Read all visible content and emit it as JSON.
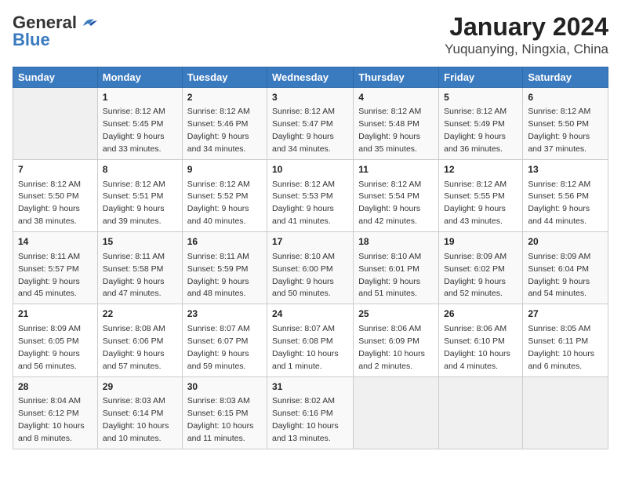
{
  "logo": {
    "general": "General",
    "blue": "Blue"
  },
  "title": "January 2024",
  "subtitle": "Yuquanying, Ningxia, China",
  "days_of_week": [
    "Sunday",
    "Monday",
    "Tuesday",
    "Wednesday",
    "Thursday",
    "Friday",
    "Saturday"
  ],
  "weeks": [
    [
      {
        "day": "",
        "info": ""
      },
      {
        "day": "1",
        "info": "Sunrise: 8:12 AM\nSunset: 5:45 PM\nDaylight: 9 hours\nand 33 minutes."
      },
      {
        "day": "2",
        "info": "Sunrise: 8:12 AM\nSunset: 5:46 PM\nDaylight: 9 hours\nand 34 minutes."
      },
      {
        "day": "3",
        "info": "Sunrise: 8:12 AM\nSunset: 5:47 PM\nDaylight: 9 hours\nand 34 minutes."
      },
      {
        "day": "4",
        "info": "Sunrise: 8:12 AM\nSunset: 5:48 PM\nDaylight: 9 hours\nand 35 minutes."
      },
      {
        "day": "5",
        "info": "Sunrise: 8:12 AM\nSunset: 5:49 PM\nDaylight: 9 hours\nand 36 minutes."
      },
      {
        "day": "6",
        "info": "Sunrise: 8:12 AM\nSunset: 5:50 PM\nDaylight: 9 hours\nand 37 minutes."
      }
    ],
    [
      {
        "day": "7",
        "info": "Sunrise: 8:12 AM\nSunset: 5:50 PM\nDaylight: 9 hours\nand 38 minutes."
      },
      {
        "day": "8",
        "info": "Sunrise: 8:12 AM\nSunset: 5:51 PM\nDaylight: 9 hours\nand 39 minutes."
      },
      {
        "day": "9",
        "info": "Sunrise: 8:12 AM\nSunset: 5:52 PM\nDaylight: 9 hours\nand 40 minutes."
      },
      {
        "day": "10",
        "info": "Sunrise: 8:12 AM\nSunset: 5:53 PM\nDaylight: 9 hours\nand 41 minutes."
      },
      {
        "day": "11",
        "info": "Sunrise: 8:12 AM\nSunset: 5:54 PM\nDaylight: 9 hours\nand 42 minutes."
      },
      {
        "day": "12",
        "info": "Sunrise: 8:12 AM\nSunset: 5:55 PM\nDaylight: 9 hours\nand 43 minutes."
      },
      {
        "day": "13",
        "info": "Sunrise: 8:12 AM\nSunset: 5:56 PM\nDaylight: 9 hours\nand 44 minutes."
      }
    ],
    [
      {
        "day": "14",
        "info": "Sunrise: 8:11 AM\nSunset: 5:57 PM\nDaylight: 9 hours\nand 45 minutes."
      },
      {
        "day": "15",
        "info": "Sunrise: 8:11 AM\nSunset: 5:58 PM\nDaylight: 9 hours\nand 47 minutes."
      },
      {
        "day": "16",
        "info": "Sunrise: 8:11 AM\nSunset: 5:59 PM\nDaylight: 9 hours\nand 48 minutes."
      },
      {
        "day": "17",
        "info": "Sunrise: 8:10 AM\nSunset: 6:00 PM\nDaylight: 9 hours\nand 50 minutes."
      },
      {
        "day": "18",
        "info": "Sunrise: 8:10 AM\nSunset: 6:01 PM\nDaylight: 9 hours\nand 51 minutes."
      },
      {
        "day": "19",
        "info": "Sunrise: 8:09 AM\nSunset: 6:02 PM\nDaylight: 9 hours\nand 52 minutes."
      },
      {
        "day": "20",
        "info": "Sunrise: 8:09 AM\nSunset: 6:04 PM\nDaylight: 9 hours\nand 54 minutes."
      }
    ],
    [
      {
        "day": "21",
        "info": "Sunrise: 8:09 AM\nSunset: 6:05 PM\nDaylight: 9 hours\nand 56 minutes."
      },
      {
        "day": "22",
        "info": "Sunrise: 8:08 AM\nSunset: 6:06 PM\nDaylight: 9 hours\nand 57 minutes."
      },
      {
        "day": "23",
        "info": "Sunrise: 8:07 AM\nSunset: 6:07 PM\nDaylight: 9 hours\nand 59 minutes."
      },
      {
        "day": "24",
        "info": "Sunrise: 8:07 AM\nSunset: 6:08 PM\nDaylight: 10 hours\nand 1 minute."
      },
      {
        "day": "25",
        "info": "Sunrise: 8:06 AM\nSunset: 6:09 PM\nDaylight: 10 hours\nand 2 minutes."
      },
      {
        "day": "26",
        "info": "Sunrise: 8:06 AM\nSunset: 6:10 PM\nDaylight: 10 hours\nand 4 minutes."
      },
      {
        "day": "27",
        "info": "Sunrise: 8:05 AM\nSunset: 6:11 PM\nDaylight: 10 hours\nand 6 minutes."
      }
    ],
    [
      {
        "day": "28",
        "info": "Sunrise: 8:04 AM\nSunset: 6:12 PM\nDaylight: 10 hours\nand 8 minutes."
      },
      {
        "day": "29",
        "info": "Sunrise: 8:03 AM\nSunset: 6:14 PM\nDaylight: 10 hours\nand 10 minutes."
      },
      {
        "day": "30",
        "info": "Sunrise: 8:03 AM\nSunset: 6:15 PM\nDaylight: 10 hours\nand 11 minutes."
      },
      {
        "day": "31",
        "info": "Sunrise: 8:02 AM\nSunset: 6:16 PM\nDaylight: 10 hours\nand 13 minutes."
      },
      {
        "day": "",
        "info": ""
      },
      {
        "day": "",
        "info": ""
      },
      {
        "day": "",
        "info": ""
      }
    ]
  ]
}
